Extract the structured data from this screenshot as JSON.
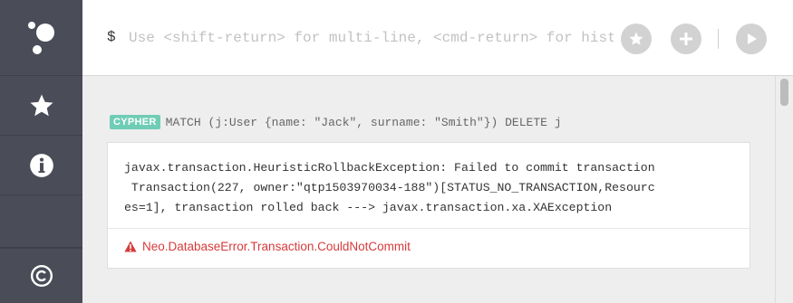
{
  "sidebar": {
    "items": [
      {
        "icon": "logo-icon"
      },
      {
        "icon": "star-icon"
      },
      {
        "icon": "info-icon"
      },
      {
        "icon": "copyright-icon"
      }
    ]
  },
  "editor": {
    "prompt": "$",
    "placeholder": "Use <shift-return> for multi-line, <cmd-return> for history",
    "buttons": [
      {
        "name": "favorite",
        "icon": "star-icon"
      },
      {
        "name": "add",
        "icon": "plus-icon"
      },
      {
        "name": "run",
        "icon": "play-icon"
      }
    ]
  },
  "frame": {
    "badge": "CYPHER",
    "command": "MATCH (j:User {name: \"Jack\", surname: \"Smith\"}) DELETE j",
    "message_lines": [
      "javax.transaction.HeuristicRollbackException: Failed to commit transaction",
      " Transaction(227, owner:\"qtp1503970034-188\")[STATUS_NO_TRANSACTION,Resourc",
      "es=1], transaction rolled back ---> javax.transaction.xa.XAException"
    ],
    "error_code": "Neo.DatabaseError.Transaction.CouldNotCommit"
  },
  "colors": {
    "sidebar": "#4a4d58",
    "badge": "#6fcdb5",
    "error": "#d63b3b"
  }
}
